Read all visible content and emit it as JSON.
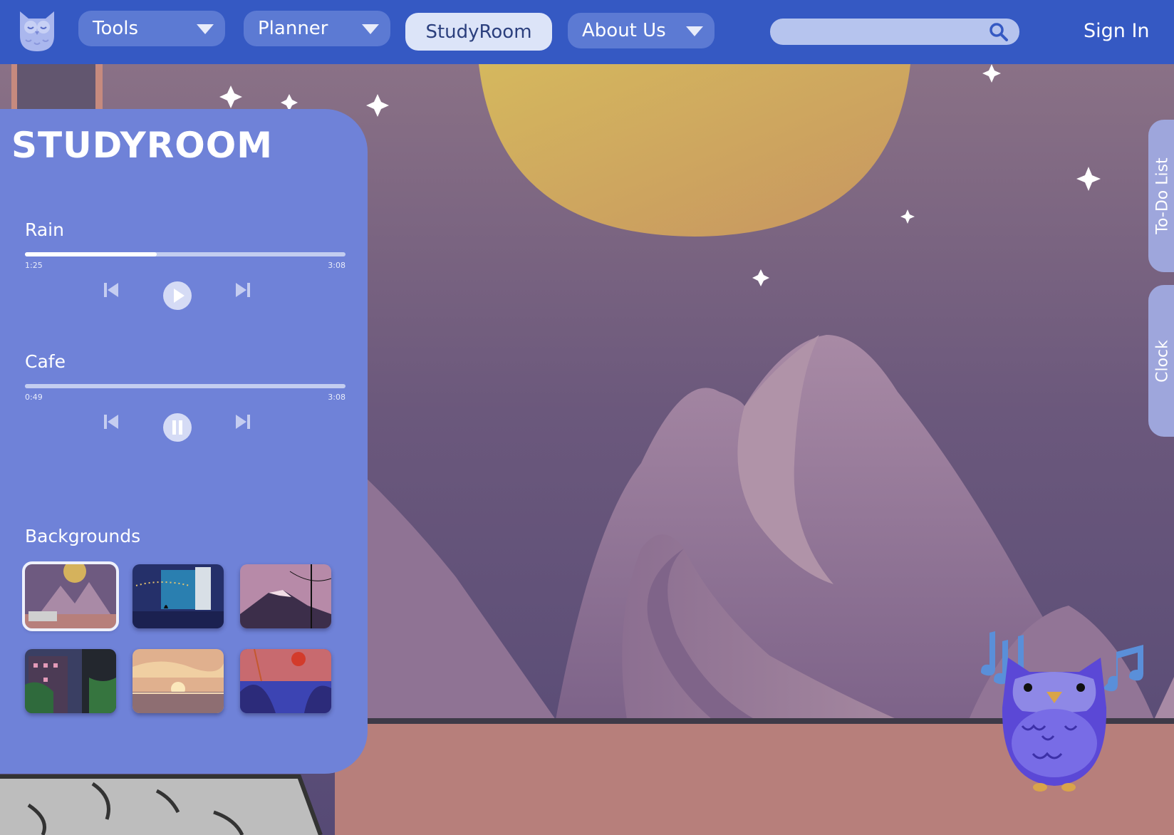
{
  "nav": {
    "tools_label": "Tools",
    "planner_label": "Planner",
    "studyroom_label": "StudyRoom",
    "about_label": "About Us",
    "search_value": "",
    "signin_label": "Sign In"
  },
  "panel": {
    "title": "STUDYROOM",
    "tracks": [
      {
        "name": "Rain",
        "current": "1:25",
        "duration": "3:08",
        "progress": 0.41,
        "state": "paused"
      },
      {
        "name": "Cafe",
        "current": "0:49",
        "duration": "3:08",
        "progress": 0.26,
        "state": "playing"
      }
    ],
    "backgrounds_label": "Backgrounds",
    "backgrounds": [
      {
        "name": "moon-mountains",
        "selected": true
      },
      {
        "name": "night-window",
        "selected": false
      },
      {
        "name": "pink-mountain",
        "selected": false
      },
      {
        "name": "night-city",
        "selected": false
      },
      {
        "name": "sunset-clouds",
        "selected": false
      },
      {
        "name": "red-moon-lake",
        "selected": false
      }
    ]
  },
  "side_tabs": {
    "todo_label": "To-Do List",
    "clock_label": "Clock"
  },
  "icons": {
    "logo": "owl-logo-icon",
    "search": "search-icon",
    "prev": "skip-previous-icon",
    "play": "play-icon",
    "pause": "pause-icon",
    "next": "skip-next-icon",
    "mascot": "owl-mascot-icon"
  },
  "colors": {
    "nav_bg": "#3559c3",
    "panel_bg": "#6f82d8",
    "moon": "#d4ad58",
    "sky": "#5c4d78",
    "desk": "#b77f7b"
  }
}
